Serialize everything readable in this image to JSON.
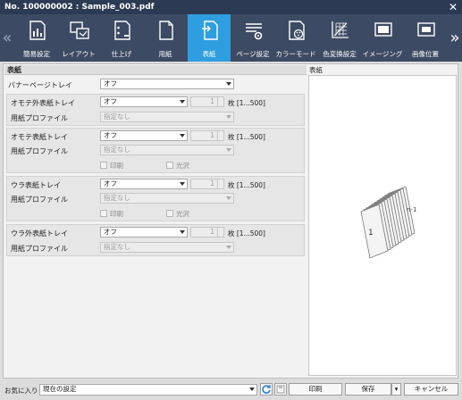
{
  "window": {
    "title": "No. 100000002 : Sample_003.pdf"
  },
  "tabs": [
    {
      "label": "簡易設定",
      "icon": "simple-settings-icon"
    },
    {
      "label": "レイアウト",
      "icon": "layout-icon"
    },
    {
      "label": "仕上げ",
      "icon": "finishing-icon"
    },
    {
      "label": "用紙",
      "icon": "paper-icon"
    },
    {
      "label": "表紙",
      "icon": "cover-icon",
      "active": true
    },
    {
      "label": "ページ設定",
      "icon": "page-settings-icon"
    },
    {
      "label": "カラーモード",
      "icon": "color-mode-icon"
    },
    {
      "label": "色変換設定",
      "icon": "color-conversion-icon"
    },
    {
      "label": "イメージング",
      "icon": "imaging-icon"
    },
    {
      "label": "画像位置",
      "icon": "image-position-icon"
    }
  ],
  "section": {
    "title": "表紙"
  },
  "banner": {
    "label": "バナーページトレイ",
    "value": "オフ"
  },
  "outer_front": {
    "label": "オモテ外表紙トレイ",
    "value": "オフ",
    "count": "1",
    "unit": "枚 [1...500]",
    "profile_label": "用紙プロファイル",
    "profile_value": "指定なし"
  },
  "front": {
    "label": "オモテ表紙トレイ",
    "value": "オフ",
    "count": "1",
    "unit": "枚 [1...500]",
    "profile_label": "用紙プロファイル",
    "profile_value": "指定なし",
    "print_label": "印刷",
    "gloss_label": "光沢"
  },
  "back": {
    "label": "ウラ表紙トレイ",
    "value": "オフ",
    "count": "1",
    "unit": "枚 [1...500]",
    "profile_label": "用紙プロファイル",
    "profile_value": "指定なし",
    "print_label": "印刷",
    "gloss_label": "光沢"
  },
  "outer_back": {
    "label": "ウラ外表紙トレイ",
    "value": "オフ",
    "count": "1",
    "unit": "枚 [1...500]",
    "profile_label": "用紙プロファイル",
    "profile_value": "指定なし"
  },
  "preview": {
    "title": "表紙",
    "page_front": "1",
    "page_back": "n-1"
  },
  "footer": {
    "favorites_label": "お気に入り",
    "favorites_value": "現在の設定",
    "print_button": "印刷",
    "save_button": "保存",
    "cancel_button": "キャンセル"
  },
  "colors": {
    "title_bg": "#2c3a54",
    "tabbar_bg": "#3d4a63",
    "accent": "#2f9ee0"
  }
}
